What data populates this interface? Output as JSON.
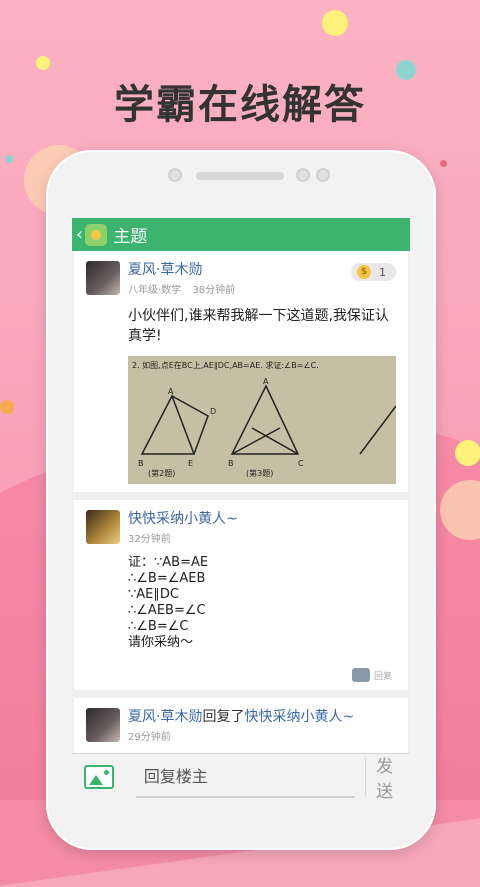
{
  "promo": {
    "headline": "学霸在线解答"
  },
  "app": {
    "header": {
      "back_icon": "chevron-left-icon",
      "title": "主题"
    },
    "question": {
      "author": "夏风·草木勋",
      "grade_subject": "八年级·数学",
      "time": "38分钟前",
      "coins": "1",
      "text": "小伙伴们,谁来帮我解一下这道题,我保证认真学!",
      "image_caption": "2. 如图,点E在BC上,AE∥DC,AB=AE. 求证:∠B=∠C.",
      "figure_labels": [
        "(第2题)",
        "(第3题)"
      ]
    },
    "answer": {
      "author": "快快采纳小黄人~",
      "time": "32分钟前",
      "text": "证：∵AB=AE\n∴∠B=∠AEB\n∵AE∥DC\n∴∠AEB=∠C\n∴∠B=∠C\n请你采纳～",
      "reply_label": "回复"
    },
    "reply": {
      "author": "夏风·草木勋",
      "reply_word": "回复了",
      "target": "快快采纳小黄人~",
      "time": "29分钟前"
    },
    "bottom": {
      "image_icon": "image-icon",
      "input_placeholder": "回复楼主",
      "send_label": "发送"
    }
  },
  "colors": {
    "accent_green": "#3cb46e",
    "name_blue": "#3867a8",
    "background_pink": "#f8a7b9"
  }
}
